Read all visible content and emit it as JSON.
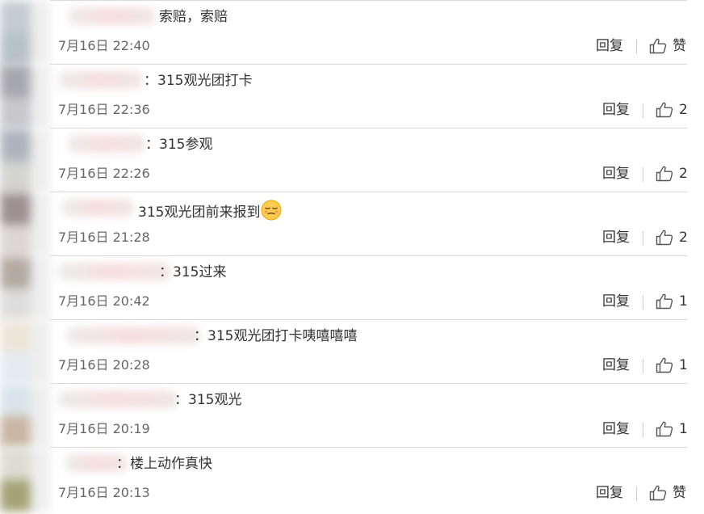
{
  "comments": [
    {
      "text": "索赔，索赔",
      "time": "7月16日 22:40",
      "reply": "回复",
      "likes": "赞"
    },
    {
      "text": "：315观光团打卡",
      "time": "7月16日 22:36",
      "reply": "回复",
      "likes": "2"
    },
    {
      "text": "：315参观",
      "time": "7月16日 22:26",
      "reply": "回复",
      "likes": "2"
    },
    {
      "text": "315观光团前来报到",
      "time": "7月16日 21:28",
      "reply": "回复",
      "likes": "2",
      "emoji": "smirk-emoji"
    },
    {
      "text": "：315过来",
      "time": "7月16日 20:42",
      "reply": "回复",
      "likes": "1"
    },
    {
      "text": "：315观光团打卡咦嘻嘻嘻",
      "time": "7月16日 20:28",
      "reply": "回复",
      "likes": "1"
    },
    {
      "text": "：315观光",
      "time": "7月16日 20:19",
      "reply": "回复",
      "likes": "1"
    },
    {
      "text": "：楼上动作真快",
      "time": "7月16日 20:13",
      "reply": "回复",
      "likes": "赞"
    }
  ],
  "colors": {
    "text": "#333333",
    "time": "#666666",
    "divider": "#d9d9d9",
    "icon": "#555555"
  }
}
